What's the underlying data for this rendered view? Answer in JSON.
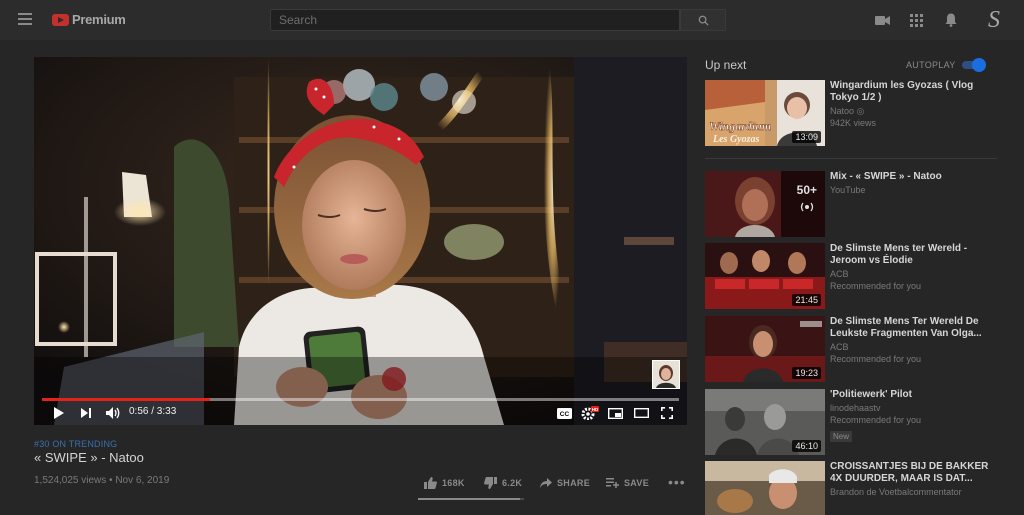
{
  "header": {
    "logo_text": "Premium",
    "search_placeholder": "Search",
    "avatar_letter": "S"
  },
  "player": {
    "current_time": "0:56",
    "duration": "3:33",
    "time_display": "0:56 / 3:33",
    "progress_fraction": 0.263,
    "hd_badge": "HD",
    "cc_label": "CC"
  },
  "video": {
    "trending": "#30 ON TRENDING",
    "title": "« SWIPE » - Natoo",
    "meta": "1,524,025 views • Nov 6, 2019",
    "likes": "168K",
    "dislikes": "6.2K",
    "share_label": "SHARE",
    "save_label": "SAVE",
    "more_label": "•••",
    "like_fraction": 0.96
  },
  "sidebar": {
    "up_next_label": "Up next",
    "autoplay_label": "AUTOPLAY",
    "autoplay_on": true,
    "items": [
      {
        "title": "Wingardium les Gyozas ( Vlog Tokyo 1/2 )",
        "channel": "Natoo ◎",
        "views": "942K views",
        "duration": "13:09",
        "badge": ""
      },
      {
        "title": "Mix - « SWIPE » - Natoo",
        "channel": "YouTube",
        "views": "",
        "duration": "",
        "badge": "",
        "mix_count": "50+"
      },
      {
        "title": "De Slimste Mens ter Wereld - Jeroom vs Élodie",
        "channel": "ACB",
        "views": "Recommended for you",
        "duration": "21:45",
        "badge": ""
      },
      {
        "title": "De Slimste Mens Ter Wereld De Leukste Fragmenten Van Olga...",
        "channel": "ACB",
        "views": "Recommended for you",
        "duration": "19:23",
        "badge": ""
      },
      {
        "title": "'Politiewerk' Pilot",
        "channel": "linodehaastv",
        "views": "Recommended for you",
        "duration": "46:10",
        "badge": "New"
      },
      {
        "title": "CROISSANTJES BIJ DE BAKKER 4X DUURDER, MAAR IS DAT...",
        "channel": "Brandon de Voetbalcommentator",
        "views": "",
        "duration": "",
        "badge": ""
      }
    ]
  },
  "colors": {
    "accent_red": "#e62117",
    "toggle_blue": "#1a6fe0",
    "trending_blue": "#3a6fb0"
  }
}
